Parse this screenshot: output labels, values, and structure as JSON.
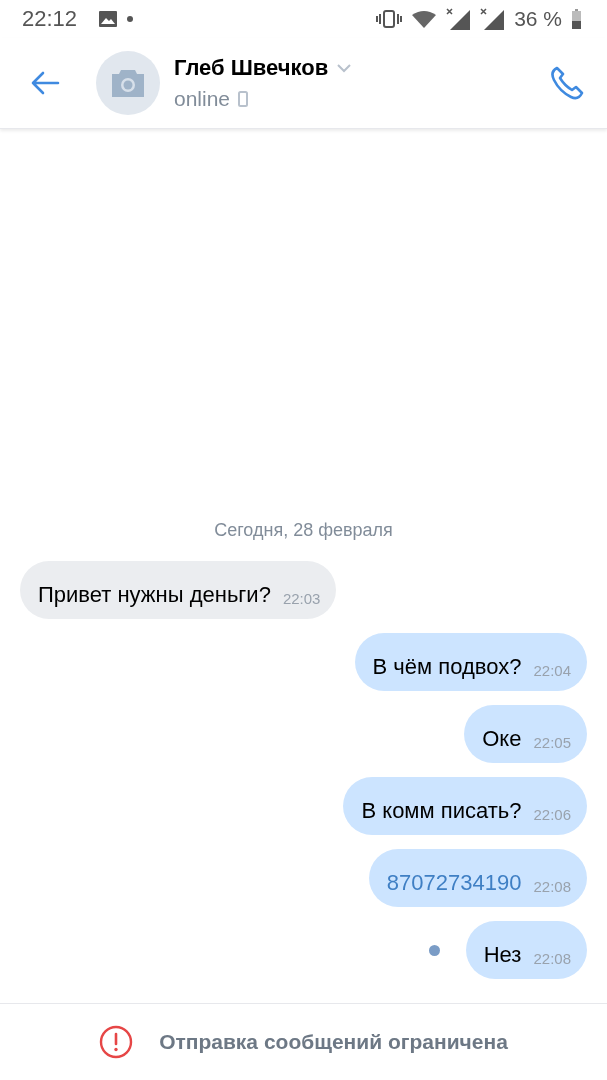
{
  "status_bar": {
    "time": "22:12",
    "battery": "36 %"
  },
  "header": {
    "name": "Глеб Швечков",
    "presence": "online"
  },
  "date_divider": "Сегодня, 28 февраля",
  "messages": [
    {
      "kind": "incoming",
      "text": "Привет нужны деньги?",
      "time": "22:03",
      "link": false,
      "unread": false
    },
    {
      "kind": "outgoing",
      "text": "В чём подвох?",
      "time": "22:04",
      "link": false,
      "unread": false
    },
    {
      "kind": "outgoing",
      "text": "Оке",
      "time": "22:05",
      "link": false,
      "unread": false
    },
    {
      "kind": "outgoing",
      "text": "В комм писать?",
      "time": "22:06",
      "link": false,
      "unread": false
    },
    {
      "kind": "outgoing",
      "text": "87072734190",
      "time": "22:08",
      "link": true,
      "unread": false
    },
    {
      "kind": "outgoing",
      "text": "Нез",
      "time": "22:08",
      "link": false,
      "unread": true
    }
  ],
  "footer": {
    "notice": "Отправка сообщений ограничена"
  }
}
